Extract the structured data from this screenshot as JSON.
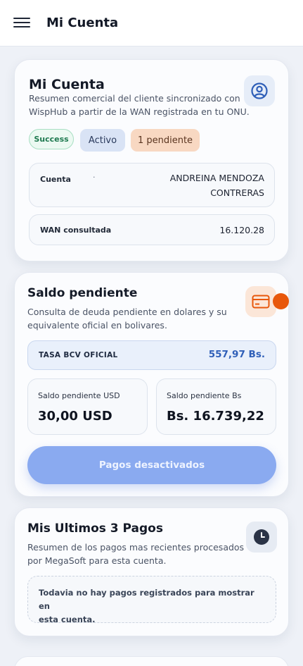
{
  "header": {
    "title": "Mi Cuenta",
    "menu_icon": "hamburger-menu-icon"
  },
  "account_card": {
    "title": "Mi Cuenta",
    "description_line1": "Resumen comercial del cliente sincronizado con",
    "description_line2": "WispHub a partir de la WAN registrada en tu ONU.",
    "icon": "user-circle-icon",
    "badges": {
      "success": "Success",
      "active": "Activo",
      "pending": "1 pendiente"
    },
    "account_label": "Cuenta",
    "account_dot": ".",
    "account_value_line1": "ANDREINA MENDOZA",
    "account_value_line2": "CONTRERAS",
    "wan_label": "WAN consultada",
    "wan_value": "16.120.28"
  },
  "balance_card": {
    "title": "Saldo pendiente",
    "description_line1": "Consulta de deuda pendiente en dolares y su",
    "description_line2": "equivalente oficial en bolivares.",
    "icon": "credit-card-icon",
    "rate_label": "TASA BCV OFICIAL",
    "rate_value": "557,97 Bs.",
    "usd_label": "Saldo pendiente USD",
    "usd_value": "30,00 USD",
    "bs_label": "Saldo pendiente Bs",
    "bs_value": "Bs. 16.739,22",
    "payments_button": "Pagos desactivados"
  },
  "payments_card": {
    "title": "Mis Ultimos 3 Pagos",
    "description_line1": "Resumen de los pagos mas recientes procesados",
    "description_line2": "por MegaSoft para esta cuenta.",
    "icon": "clock-icon",
    "empty_line1": "Todavia no hay pagos registrados para mostrar en",
    "empty_line2": "esta cuenta."
  },
  "colors": {
    "accent_blue": "#2f5fb8",
    "orange": "#e8580c",
    "button_disabled": "#8aaaf0",
    "success_green": "#1f7a50"
  }
}
